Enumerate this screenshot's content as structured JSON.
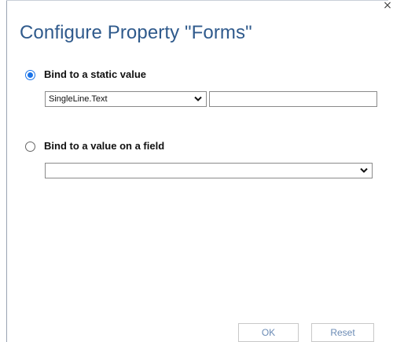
{
  "dialog": {
    "title": "Configure Property \"Forms\"",
    "close_glyph": "×"
  },
  "static_option": {
    "label": "Bind to a static value",
    "checked": true,
    "type_select_value": "SingleLine.Text",
    "value_input": ""
  },
  "field_option": {
    "label": "Bind to a value on a field",
    "checked": false,
    "field_select_value": ""
  },
  "buttons": {
    "ok_label": "OK",
    "reset_label": "Reset"
  },
  "colors": {
    "title": "#2f5a8c",
    "radio_accent": "#1a73e8",
    "button_text": "#6b8bb5"
  },
  "icons": {
    "close": "close-icon",
    "dropdown": "chevron-down-icon"
  }
}
